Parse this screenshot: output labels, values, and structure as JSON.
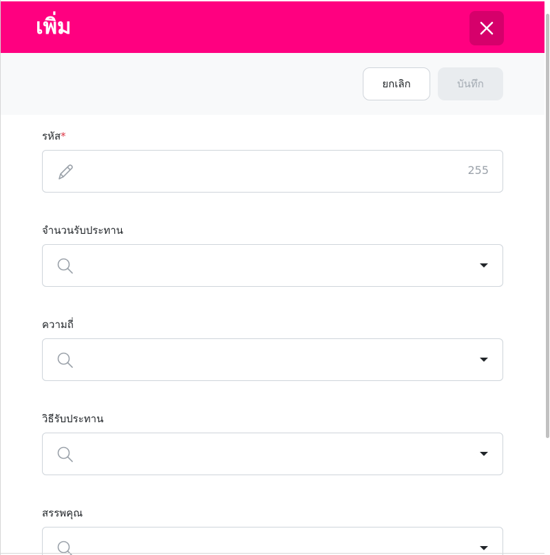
{
  "modal": {
    "title": "เพิ่ม",
    "close_icon": "close-icon",
    "accent_color": "#ff0080"
  },
  "toolbar": {
    "cancel_label": "ยกเลิก",
    "save_label": "บันทึก"
  },
  "form": {
    "code": {
      "label": "รหัส",
      "required_mark": "*",
      "value": "",
      "max_length_counter": "255",
      "icon": "pencil-icon"
    },
    "insured_amount": {
      "label": "จำนวนรับประทาน",
      "selected": "",
      "icon": "search-icon"
    },
    "frequency": {
      "label": "ความถี่",
      "selected": "",
      "icon": "search-icon"
    },
    "intake_method": {
      "label": "วิธีรับประทาน",
      "selected": "",
      "icon": "search-icon"
    },
    "properties": {
      "label": "สรรพคุณ",
      "selected": "",
      "icon": "search-icon"
    }
  }
}
